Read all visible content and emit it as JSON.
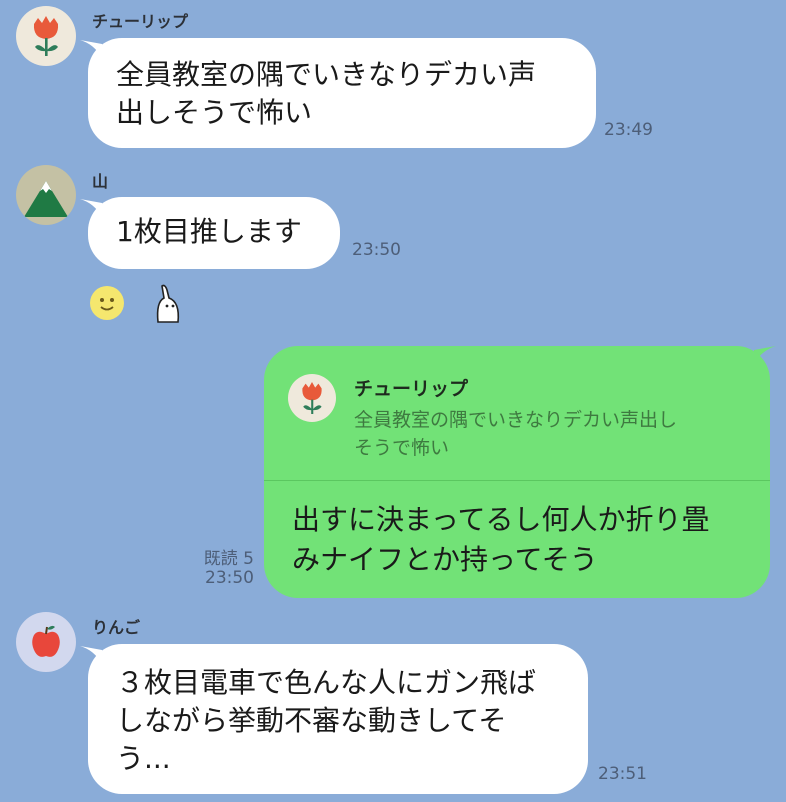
{
  "messages": [
    {
      "sender": "チューリップ",
      "text": "全員教室の隅でいきなりデカい声出しそうで怖い",
      "line1": "全員教室の隅でいきなりデカい声",
      "line2": "出しそうで怖い",
      "time": "23:49",
      "avatar_icon": "tulip-icon"
    },
    {
      "sender": "山",
      "text": "1枚目推します",
      "time": "23:50",
      "avatar_icon": "mountain-icon",
      "reactions": [
        "smiley-emoji-icon",
        "waving-character-sticker-icon"
      ]
    },
    {
      "own": true,
      "quote_sender": "チューリップ",
      "quote_line1": "全員教室の隅でいきなりデカい声出し",
      "quote_line2": "そうで怖い",
      "line1": "出すに決まってるし何人か折り畳",
      "line2": "みナイフとか持ってそう",
      "read": "既読 5",
      "time": "23:50"
    },
    {
      "sender": "りんご",
      "line1": "３枚目電車で色んな人にガン飛ば",
      "line2": "しながら挙動不審な動きしてそ",
      "line3": "う...",
      "time": "23:51",
      "avatar_icon": "apple-icon"
    }
  ],
  "colors": {
    "background": "#8aacd8",
    "own_bubble": "#72e277",
    "other_bubble": "#ffffff",
    "quote_text": "#3e7a40"
  }
}
